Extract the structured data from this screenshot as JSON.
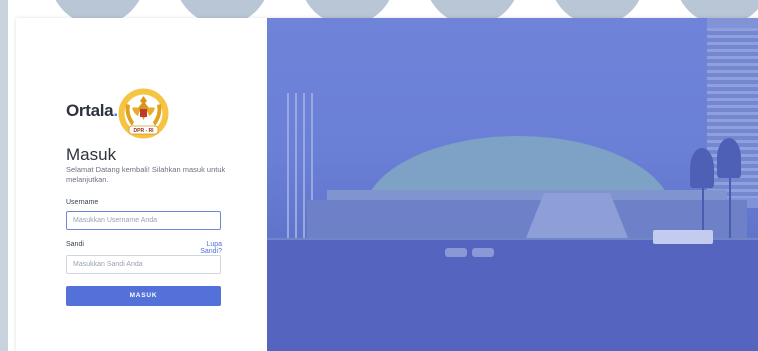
{
  "brand": {
    "name": "Ortala",
    "dot": ".",
    "emblem_label": "DPR - RI"
  },
  "login": {
    "title": "Masuk",
    "subtitle": "Selamat Datang kembali! Silahkan masuk untuk melanjutkan.",
    "username_label": "Username",
    "username_placeholder": "Masukkan Username Anda",
    "password_label": "Sandi",
    "forgot_label": "Lupa Sandi?",
    "password_placeholder": "Masukkan Sandi Anda",
    "submit_label": "MASUK"
  },
  "colors": {
    "accent": "#5470d9",
    "link": "#4f6fd8",
    "overlay": "#6f83d9"
  }
}
